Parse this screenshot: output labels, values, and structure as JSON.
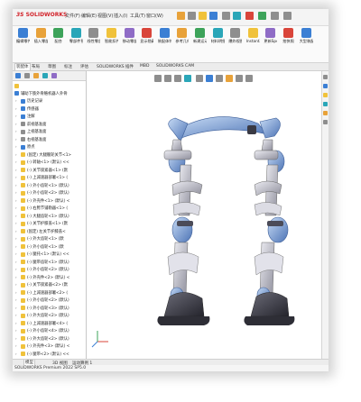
{
  "app": {
    "logo_prefix": "3S",
    "logo_text": "SOLIDWORKS",
    "menu": [
      "文件(F)",
      "编辑(E)",
      "视图(V)",
      "插入(I)",
      "工具(T)",
      "窗口(W)"
    ]
  },
  "ribbon": {
    "buttons": [
      {
        "label": "编辑零件",
        "icon": "edit-part-icon"
      },
      {
        "label": "插入零部件",
        "icon": "insert-component-icon"
      },
      {
        "label": "配合",
        "icon": "mate-icon"
      },
      {
        "label": "零部件预览窗口",
        "icon": "component-preview-icon"
      },
      {
        "label": "线性零部件阵列",
        "icon": "linear-pattern-icon"
      },
      {
        "label": "智能扣件",
        "icon": "smart-fasteners-icon"
      },
      {
        "label": "移动零部件",
        "icon": "move-component-icon"
      },
      {
        "label": "显示隐藏的零部件",
        "icon": "show-hidden-icon"
      },
      {
        "label": "装配体特征",
        "icon": "assembly-feature-icon"
      },
      {
        "label": "参考几何体",
        "icon": "reference-geometry-icon"
      },
      {
        "label": "新建运动算例",
        "icon": "motion-study-icon"
      },
      {
        "label": "材料明细表",
        "icon": "bom-icon"
      },
      {
        "label": "爆炸视图",
        "icon": "exploded-view-icon"
      },
      {
        "label": "Instant3D",
        "icon": "instant3d-icon"
      },
      {
        "label": "更新Speedpak子装配体",
        "icon": "speedpak-icon"
      },
      {
        "label": "拍快照",
        "icon": "snapshot-icon"
      },
      {
        "label": "大型装配体设置",
        "icon": "large-assembly-icon"
      }
    ]
  },
  "command_tabs": [
    "装配体",
    "布局",
    "草图",
    "标注",
    "评估",
    "SOLIDWORKS 插件",
    "MBD",
    "SOLIDWORKS CAM"
  ],
  "active_command_tab": "装配体",
  "tree": {
    "root": "辅助下肢外骨骼机器人外骨",
    "items": [
      {
        "text": "历史记录",
        "icon": "history-icon"
      },
      {
        "text": "传感器",
        "icon": "sensor-icon"
      },
      {
        "text": "注解",
        "icon": "annotation-icon"
      },
      {
        "text": "前视基准面",
        "icon": "plane-icon"
      },
      {
        "text": "上视基准面",
        "icon": "plane-icon"
      },
      {
        "text": "右视基准面",
        "icon": "plane-icon"
      },
      {
        "text": "原点",
        "icon": "origin-icon"
      },
      {
        "text": "(固定) 大腿髋轮关节<1>",
        "icon": "part-icon"
      },
      {
        "text": "(-) 转轴<1> (默认) <<",
        "icon": "part-icon"
      },
      {
        "text": "(-) 关节锁紧器<1> (默",
        "icon": "part-icon"
      },
      {
        "text": "(-) 上减速器部署<1> (",
        "icon": "part-icon"
      },
      {
        "text": "(-) 外小齿轮<1> (默认)",
        "icon": "part-icon"
      },
      {
        "text": "(-) 外小齿轮<2> (默认)",
        "icon": "part-icon"
      },
      {
        "text": "(-) 外壳件<1> (默认) <",
        "icon": "part-icon"
      },
      {
        "text": "(-) 右胯节铺勒器<1> (",
        "icon": "part-icon"
      },
      {
        "text": "(-) 大腿齿轮<1> (默认)",
        "icon": "part-icon"
      },
      {
        "text": "(-) 关节护膝盖<1> (默",
        "icon": "part-icon"
      },
      {
        "text": "(固定) 左关节护膝盖<",
        "icon": "part-icon"
      },
      {
        "text": "(-) 外大齿轮<1> (默",
        "icon": "part-icon"
      },
      {
        "text": "(-) 外小齿轮<1> (默",
        "icon": "part-icon"
      },
      {
        "text": "(-) 腿托<1> (默认) <<",
        "icon": "part-icon"
      },
      {
        "text": "(-) 腿带齿轮<1> (默认)",
        "icon": "part-icon"
      },
      {
        "text": "(-) 外小齿轮<2> (默认)",
        "icon": "part-icon"
      },
      {
        "text": "(-) 外壳件<2> (默认) <",
        "icon": "part-icon"
      },
      {
        "text": "(-) 关节锁紧器<2> (默",
        "icon": "part-icon"
      },
      {
        "text": "(-) 上减速器部署<2> (",
        "icon": "part-icon"
      },
      {
        "text": "(-) 外小齿轮<2> (默认)",
        "icon": "part-icon"
      },
      {
        "text": "(-) 外小齿轮<3> (默认)",
        "icon": "part-icon"
      },
      {
        "text": "(-) 外大齿轮<2> (默认)",
        "icon": "part-icon"
      },
      {
        "text": "(-) 上减速器部署<4> (",
        "icon": "part-icon"
      },
      {
        "text": "(-) 外小齿轮<4> (默认)",
        "icon": "part-icon"
      },
      {
        "text": "(-) 外大齿轮<2> (默认)",
        "icon": "part-icon"
      },
      {
        "text": "(-) 外壳件<3> (默认) <",
        "icon": "part-icon"
      },
      {
        "text": "(-) 腿带<2> (默认) <<",
        "icon": "part-icon"
      }
    ]
  },
  "bottom_tabs": [
    "模型",
    "3D 视图",
    "运动算例 1"
  ],
  "active_bottom_tab": "模型",
  "status_text": "SOLIDWORKS Premium 2022 SP5.0",
  "colors": {
    "robot_blue": "#8fb3e3",
    "robot_blue_dark": "#4c73b5",
    "robot_gray": "#b8b8c4",
    "robot_dark": "#3a3a44"
  }
}
